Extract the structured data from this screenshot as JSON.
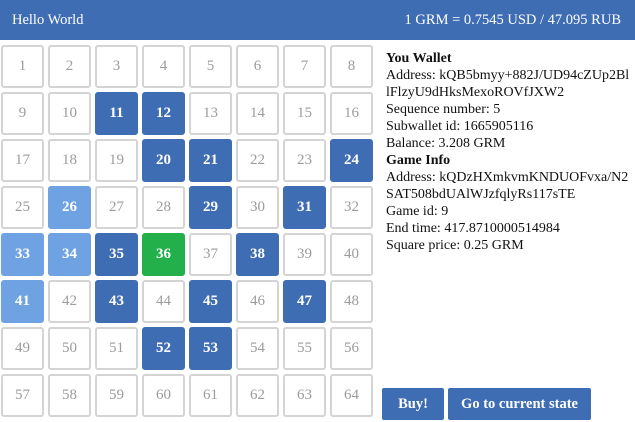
{
  "header": {
    "title": "Hello World",
    "rate": "1 GRM = 0.7545 USD / 47.095 RUB"
  },
  "board": {
    "cells": [
      {
        "n": "1",
        "s": "free"
      },
      {
        "n": "2",
        "s": "free"
      },
      {
        "n": "3",
        "s": "free"
      },
      {
        "n": "4",
        "s": "free"
      },
      {
        "n": "5",
        "s": "free"
      },
      {
        "n": "6",
        "s": "free"
      },
      {
        "n": "7",
        "s": "free"
      },
      {
        "n": "8",
        "s": "free"
      },
      {
        "n": "9",
        "s": "free"
      },
      {
        "n": "10",
        "s": "free"
      },
      {
        "n": "11",
        "s": "owned"
      },
      {
        "n": "12",
        "s": "owned"
      },
      {
        "n": "13",
        "s": "free"
      },
      {
        "n": "14",
        "s": "free"
      },
      {
        "n": "15",
        "s": "free"
      },
      {
        "n": "16",
        "s": "free"
      },
      {
        "n": "17",
        "s": "free"
      },
      {
        "n": "18",
        "s": "free"
      },
      {
        "n": "19",
        "s": "free"
      },
      {
        "n": "20",
        "s": "owned"
      },
      {
        "n": "21",
        "s": "owned"
      },
      {
        "n": "22",
        "s": "free"
      },
      {
        "n": "23",
        "s": "free"
      },
      {
        "n": "24",
        "s": "owned"
      },
      {
        "n": "25",
        "s": "free"
      },
      {
        "n": "26",
        "s": "light"
      },
      {
        "n": "27",
        "s": "free"
      },
      {
        "n": "28",
        "s": "free"
      },
      {
        "n": "29",
        "s": "owned"
      },
      {
        "n": "30",
        "s": "free"
      },
      {
        "n": "31",
        "s": "owned"
      },
      {
        "n": "32",
        "s": "free"
      },
      {
        "n": "33",
        "s": "light"
      },
      {
        "n": "34",
        "s": "light"
      },
      {
        "n": "35",
        "s": "owned"
      },
      {
        "n": "36",
        "s": "current"
      },
      {
        "n": "37",
        "s": "free"
      },
      {
        "n": "38",
        "s": "owned"
      },
      {
        "n": "39",
        "s": "free"
      },
      {
        "n": "40",
        "s": "free"
      },
      {
        "n": "41",
        "s": "light"
      },
      {
        "n": "42",
        "s": "free"
      },
      {
        "n": "43",
        "s": "owned"
      },
      {
        "n": "44",
        "s": "free"
      },
      {
        "n": "45",
        "s": "owned"
      },
      {
        "n": "46",
        "s": "free"
      },
      {
        "n": "47",
        "s": "owned"
      },
      {
        "n": "48",
        "s": "free"
      },
      {
        "n": "49",
        "s": "free"
      },
      {
        "n": "50",
        "s": "free"
      },
      {
        "n": "51",
        "s": "free"
      },
      {
        "n": "52",
        "s": "owned"
      },
      {
        "n": "53",
        "s": "owned"
      },
      {
        "n": "54",
        "s": "free"
      },
      {
        "n": "55",
        "s": "free"
      },
      {
        "n": "56",
        "s": "free"
      },
      {
        "n": "57",
        "s": "free"
      },
      {
        "n": "58",
        "s": "free"
      },
      {
        "n": "59",
        "s": "free"
      },
      {
        "n": "60",
        "s": "free"
      },
      {
        "n": "61",
        "s": "free"
      },
      {
        "n": "62",
        "s": "free"
      },
      {
        "n": "63",
        "s": "free"
      },
      {
        "n": "64",
        "s": "free"
      }
    ]
  },
  "wallet": {
    "heading": "You Wallet",
    "address": "Address: kQB5bmyy+882J/UD94cZUp2BllFlzyU9dHksMexoROVfJXW2",
    "sequence": "Sequence number: 5",
    "subwallet": "Subwallet id: 1665905116",
    "balance": "Balance: 3.208 GRM"
  },
  "game": {
    "heading": "Game Info",
    "address": "Address: kQDzHXmkvmKNDUOFvxa/N2SAT508bdUAlWJzfqlyRs117sTE",
    "game_id": "Game id: 9",
    "end_time": "End time: 417.8710000514984",
    "square_price": "Square price: 0.25 GRM"
  },
  "actions": {
    "buy_label": "Buy!",
    "current_state_label": "Go to current state"
  },
  "colors": {
    "primary": "#3f6db3",
    "light_owned": "#6fa2e3",
    "current": "#23b04a",
    "cell_border": "#d4d4d4"
  }
}
